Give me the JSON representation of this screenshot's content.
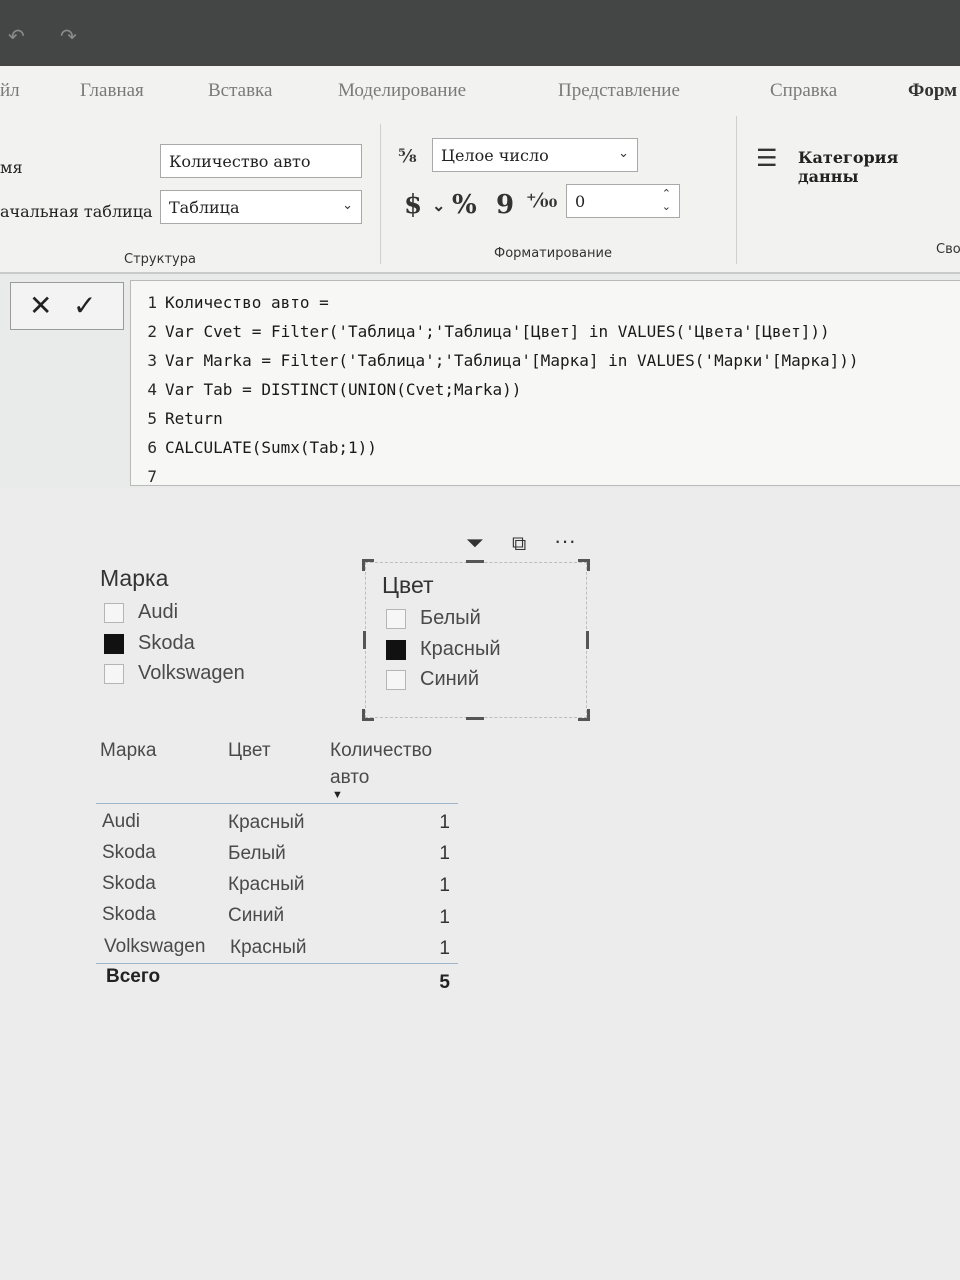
{
  "ribbon": {
    "tabs": [
      "йл",
      "Главная",
      "Вставка",
      "Моделирование",
      "Представление",
      "Справка",
      "Форм"
    ],
    "name_label": "мя",
    "name_value": "Количество авто",
    "home_table_label": "ачальная таблица",
    "home_table_value": "Таблица",
    "group_structure": "Структура",
    "format_value": "Целое число",
    "format_symbols": [
      "$",
      "%",
      "9"
    ],
    "decimals_value": "0",
    "group_formatting": "Форматирование",
    "data_category_label": "Категория данны",
    "group_properties": "Сво"
  },
  "formula": {
    "lines": [
      {
        "n": "1",
        "text": "Количество авто ="
      },
      {
        "n": "2",
        "text": "Var Cvet = Filter('Таблица';'Таблица'[Цвет] in VALUES('Цвета'[Цвет]))"
      },
      {
        "n": "3",
        "text": "Var Marka = Filter('Таблица';'Таблица'[Марка] in VALUES('Марки'[Марка]))"
      },
      {
        "n": "4",
        "text": "Var Tab = DISTINCT(UNION(Cvet;Marka))"
      },
      {
        "n": "5",
        "text": "Return"
      },
      {
        "n": "6",
        "text": "CALCULATE(Sumx(Tab;1))"
      },
      {
        "n": "7",
        "text": ""
      }
    ]
  },
  "slicer_brand": {
    "title": "Марка",
    "items": [
      {
        "label": "Audi",
        "checked": false
      },
      {
        "label": "Skoda",
        "checked": true
      },
      {
        "label": "Volkswagen",
        "checked": false
      }
    ]
  },
  "slicer_color": {
    "title": "Цвет",
    "items": [
      {
        "label": "Белый",
        "checked": false
      },
      {
        "label": "Красный",
        "checked": true
      },
      {
        "label": "Синий",
        "checked": false
      }
    ]
  },
  "table": {
    "headers": [
      "Марка",
      "Цвет",
      "Количество",
      "авто"
    ],
    "rows": [
      [
        "Audi",
        "Красный",
        "1"
      ],
      [
        "Skoda",
        "Белый",
        "1"
      ],
      [
        "Skoda",
        "Красный",
        "1"
      ],
      [
        "Skoda",
        "Синий",
        "1"
      ],
      [
        "Volkswagen",
        "Красный",
        "1"
      ]
    ],
    "total_label": "Всего",
    "total_value": "5"
  }
}
